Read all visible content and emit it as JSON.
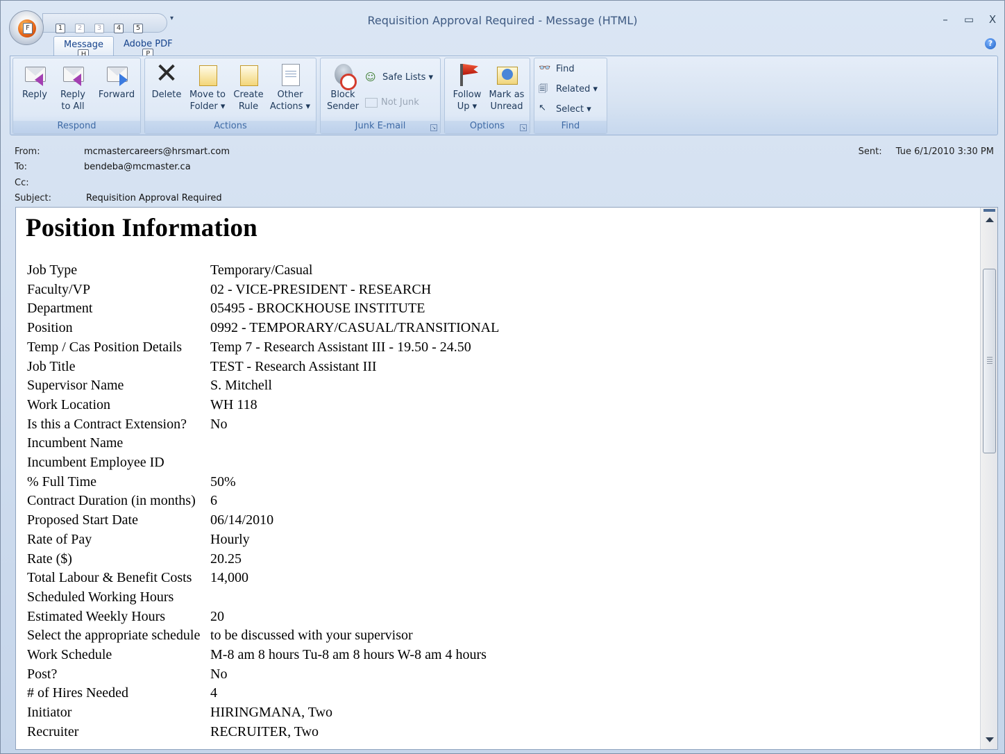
{
  "window": {
    "title": "Requisition Approval Required - Message (HTML)",
    "orb_keytip": "F",
    "qat_keytips": [
      "1",
      "2",
      "3",
      "4",
      "5"
    ],
    "minimize": "–",
    "maximize": "▭",
    "close": "X"
  },
  "tabs": [
    {
      "label": "Message",
      "keytip": "H",
      "active": true
    },
    {
      "label": "Adobe PDF",
      "keytip": "P",
      "active": false
    }
  ],
  "ribbon": {
    "respond": {
      "label": "Respond",
      "reply": "Reply",
      "reply_all_1": "Reply",
      "reply_all_2": "to All",
      "forward": "Forward"
    },
    "actions": {
      "label": "Actions",
      "delete": "Delete",
      "move_1": "Move to",
      "move_2": "Folder ▾",
      "create_1": "Create",
      "create_2": "Rule",
      "other_1": "Other",
      "other_2": "Actions ▾"
    },
    "junk": {
      "label": "Junk E-mail",
      "block_1": "Block",
      "block_2": "Sender",
      "safe_lists": "Safe Lists ▾",
      "not_junk": "Not Junk"
    },
    "options": {
      "label": "Options",
      "follow_1": "Follow",
      "follow_2": "Up ▾",
      "mark_1": "Mark as",
      "mark_2": "Unread"
    },
    "find": {
      "label": "Find",
      "find": "Find",
      "related": "Related ▾",
      "select": "Select ▾"
    }
  },
  "header": {
    "from_label": "From:",
    "from": "mcmastercareers@hrsmart.com",
    "to_label": "To:",
    "to": "bendeba@mcmaster.ca",
    "cc_label": "Cc:",
    "cc": "",
    "subject_label": "Subject:",
    "subject": "Requisition Approval Required",
    "sent_label": "Sent:",
    "sent": "Tue 6/1/2010 3:30 PM"
  },
  "message": {
    "heading": "Position Information",
    "rows": [
      {
        "k": "Job Type",
        "v": "Temporary/Casual"
      },
      {
        "k": "Faculty/VP",
        "v": "02 - VICE-PRESIDENT - RESEARCH"
      },
      {
        "k": "Department",
        "v": "05495 - BROCKHOUSE INSTITUTE"
      },
      {
        "k": "Position",
        "v": "0992 - TEMPORARY/CASUAL/TRANSITIONAL"
      },
      {
        "k": "Temp / Cas Position Details",
        "v": "Temp 7 - Research Assistant III - 19.50 - 24.50"
      },
      {
        "k": "Job Title",
        "v": "TEST - Research Assistant III"
      },
      {
        "k": "Supervisor Name",
        "v": "S. Mitchell"
      },
      {
        "k": "Work Location",
        "v": "WH 118"
      },
      {
        "k": "Is this a Contract Extension?",
        "v": "No"
      },
      {
        "k": "Incumbent Name",
        "v": ""
      },
      {
        "k": "Incumbent Employee ID",
        "v": ""
      },
      {
        "k": "% Full Time",
        "v": "50%"
      },
      {
        "k": "Contract Duration (in months)",
        "v": "6"
      },
      {
        "k": "Proposed Start Date",
        "v": "06/14/2010"
      },
      {
        "k": "Rate of Pay",
        "v": "Hourly"
      },
      {
        "k": "Rate ($)",
        "v": "20.25"
      },
      {
        "k": "Total Labour & Benefit Costs",
        "v": "14,000"
      },
      {
        "k": "Scheduled Working Hours",
        "v": ""
      },
      {
        "k": "Estimated Weekly Hours",
        "v": "20"
      },
      {
        "k": "Select the appropriate schedule",
        "v": "to be discussed with your supervisor"
      },
      {
        "k": "Work Schedule",
        "v": "M-8 am 8 hours Tu-8 am 8 hours W-8 am 4 hours"
      },
      {
        "k": "Post?",
        "v": "No"
      },
      {
        "k": "# of Hires Needed",
        "v": "4"
      },
      {
        "k": "Initiator",
        "v": "HIRINGMANA, Two"
      },
      {
        "k": "Recruiter",
        "v": "RECRUITER, Two"
      }
    ]
  },
  "scrollbar": {
    "position": 0.14
  }
}
